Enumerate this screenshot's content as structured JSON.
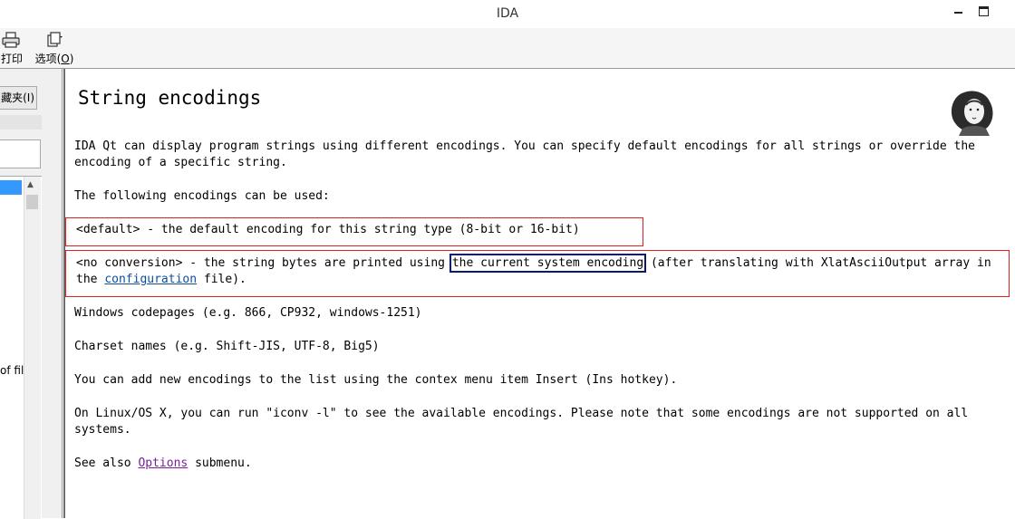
{
  "window": {
    "title": "IDA"
  },
  "toolbar": {
    "print_label": "打印",
    "options_label_prefix": "选项(",
    "options_mnemonic": "O",
    "options_label_suffix": ")"
  },
  "left_panel": {
    "tab_label": "藏夹(I)",
    "list_text": "of fil"
  },
  "help": {
    "title": "String encodings",
    "intro": "IDA Qt can display program strings using different encodings. You can specify default encodings for all strings or override the encoding of a specific string.",
    "following": "The following encodings can be used:",
    "default_item": "<default> - the default encoding for this string type (8-bit or 16-bit)",
    "noconv": {
      "prefix": "<no conversion> - the string bytes are printed using ",
      "highlight": "the current system encoding",
      "middle": " (after translating with XlatAsciiOutput array in the ",
      "link": "configuration",
      "suffix": " file)."
    },
    "codepages": "Windows codepages (e.g. 866, CP932, windows-1251)",
    "charsets": "Charset names (e.g. Shift-JIS, UTF-8, Big5)",
    "add_encodings": "You can add new encodings to the list using the contex menu item Insert (Ins hotkey).",
    "linux": "On Linux/OS X, you can run \"iconv -l\" to see the available encodings. Please note that some encodings are not supported on all systems.",
    "see_also": {
      "prefix": "See also ",
      "link": "Options",
      "suffix": " submenu."
    }
  },
  "colors": {
    "red_box": "#e02020",
    "navy_box": "#0a1a6e",
    "link": "#0c4f9e",
    "visited_link": "#7a1e9e"
  }
}
